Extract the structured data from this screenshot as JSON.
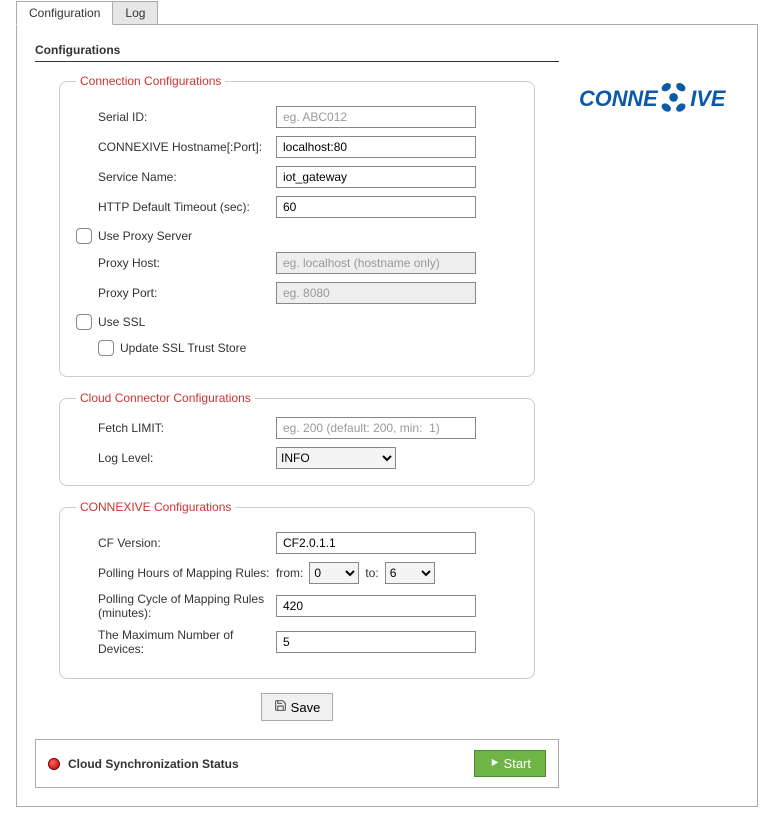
{
  "tabs": {
    "configuration": "Configuration",
    "log": "Log"
  },
  "panel_title": "Configurations",
  "logo_text_left": "CONNE",
  "logo_text_right": "IVE",
  "connection": {
    "legend": "Connection Configurations",
    "serial_id": {
      "label": "Serial ID:",
      "value": "",
      "placeholder": "eg. ABC012"
    },
    "hostname": {
      "label": "CONNEXIVE Hostname[:Port]:",
      "value": "localhost:80"
    },
    "service": {
      "label": "Service Name:",
      "value": "iot_gateway"
    },
    "timeout": {
      "label": "HTTP Default Timeout (sec):",
      "value": "60"
    },
    "use_proxy": {
      "label": "Use Proxy Server",
      "checked": false
    },
    "proxy_host": {
      "label": "Proxy Host:",
      "value": "",
      "placeholder": "eg. localhost (hostname only)"
    },
    "proxy_port": {
      "label": "Proxy Port:",
      "value": "",
      "placeholder": "eg. 8080"
    },
    "use_ssl": {
      "label": "Use SSL",
      "checked": false
    },
    "update_trust": {
      "label": "Update SSL Trust Store",
      "checked": false
    }
  },
  "cloud_connector": {
    "legend": "Cloud Connector Configurations",
    "fetch_limit": {
      "label": "Fetch LIMIT:",
      "value": "",
      "placeholder": "eg. 200 (default: 200, min:  1)"
    },
    "log_level": {
      "label": "Log Level:",
      "value": "INFO"
    }
  },
  "connexive": {
    "legend": "CONNEXIVE Configurations",
    "cf_version": {
      "label": "CF Version:",
      "value": "CF2.0.1.1"
    },
    "polling_hours": {
      "label": "Polling Hours of Mapping Rules:",
      "from_label": "from:",
      "from_value": "0",
      "to_label": "to:",
      "to_value": "6"
    },
    "polling_cycle": {
      "label": "Polling Cycle of Mapping Rules (minutes):",
      "value": "420"
    },
    "max_devices": {
      "label": "The Maximum Number of Devices:",
      "value": "5"
    }
  },
  "save_button": "Save",
  "status": {
    "label": "Cloud Synchronization Status",
    "start": "Start"
  }
}
